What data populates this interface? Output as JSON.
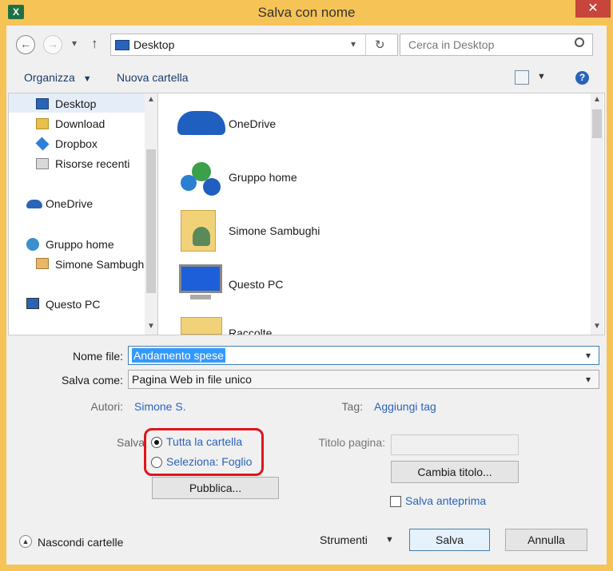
{
  "window": {
    "title": "Salva con nome",
    "close": "✕",
    "app_icon": "X"
  },
  "nav": {
    "back_icon": "←",
    "forward_icon": "→",
    "dropdown_icon": "▾",
    "up_icon": "↑",
    "address": "Desktop",
    "refresh_icon": "↻",
    "search_placeholder": "Cerca in Desktop"
  },
  "toolbar": {
    "organize": "Organizza",
    "new_folder": "Nuova cartella"
  },
  "sidebar": {
    "items": [
      {
        "label": "Desktop"
      },
      {
        "label": "Download"
      },
      {
        "label": "Dropbox"
      },
      {
        "label": "Risorse recenti"
      },
      {
        "label": "OneDrive"
      },
      {
        "label": "Gruppo home"
      },
      {
        "label": "Simone Sambughi"
      },
      {
        "label": "Questo PC"
      }
    ]
  },
  "files": [
    {
      "label": "OneDrive"
    },
    {
      "label": "Gruppo home"
    },
    {
      "label": "Simone Sambughi"
    },
    {
      "label": "Questo PC"
    },
    {
      "label": "Raccolte"
    }
  ],
  "form": {
    "filename_label": "Nome file:",
    "filename_value": "Andamento spese",
    "type_label": "Salva come:",
    "type_value": "Pagina Web in file unico",
    "authors_label": "Autori:",
    "authors_value": "Simone S.",
    "tags_label": "Tag:",
    "tags_value": "Aggiungi tag",
    "save_label": "Salva",
    "radio_entire": "Tutta la cartella",
    "radio_selection": "Seleziona: Foglio",
    "publish_button": "Pubblica...",
    "page_title_label": "Titolo pagina:",
    "change_title_button": "Cambia titolo...",
    "save_thumbnail": "Salva anteprima"
  },
  "footer": {
    "hide_folders": "Nascondi cartelle",
    "tools": "Strumenti",
    "save": "Salva",
    "cancel": "Annulla"
  }
}
